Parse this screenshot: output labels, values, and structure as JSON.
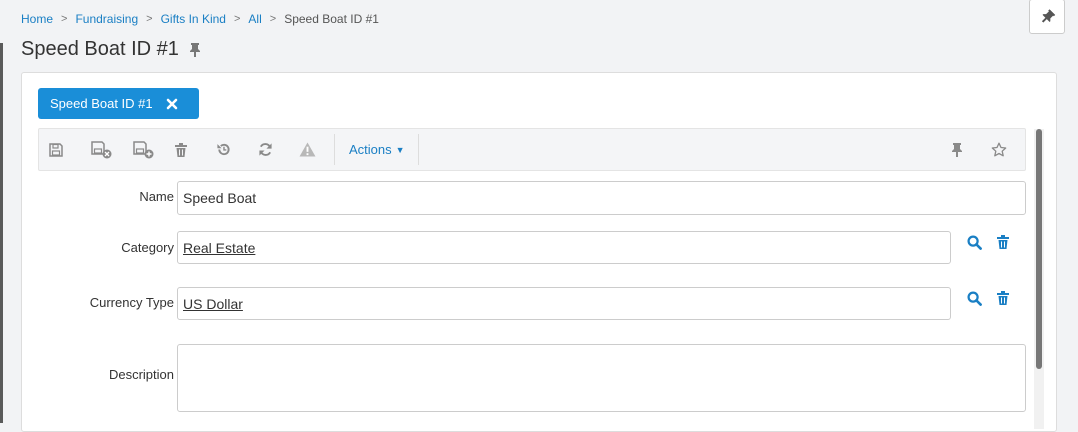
{
  "breadcrumb": {
    "items": [
      "Home",
      "Fundraising",
      "Gifts In Kind",
      "All"
    ],
    "current": "Speed Boat ID #1"
  },
  "page": {
    "title": "Speed Boat ID #1"
  },
  "record_tab": {
    "label": "Speed Boat ID #1"
  },
  "toolbar": {
    "icons": [
      "save-icon",
      "save-close-icon",
      "save-new-icon",
      "delete-icon",
      "undo-icon",
      "refresh-icon",
      "warning-icon",
      "pin-icon",
      "star-icon"
    ],
    "actions_label": "Actions"
  },
  "form": {
    "name": {
      "label": "Name",
      "value": "Speed Boat"
    },
    "category": {
      "label": "Category",
      "value": "Real Estate"
    },
    "currency_type": {
      "label": "Currency Type",
      "value": "US Dollar"
    },
    "description": {
      "label": "Description",
      "value": ""
    }
  },
  "colors": {
    "accent": "#1a8ed8",
    "link": "#1a7fc4",
    "background": "#f2f3f5"
  }
}
